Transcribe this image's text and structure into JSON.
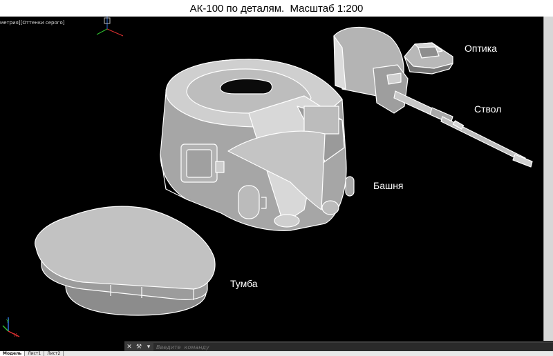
{
  "title": "АК-100 по деталям.  Масштаб 1:200",
  "viewport": {
    "label": "метрия][Оттенки серого]"
  },
  "labels": {
    "optics": "Оптика",
    "barrel": "Ствол",
    "turret": "Башня",
    "pedestal": "Тумба"
  },
  "command_line": {
    "placeholder": "Введите  команду",
    "close_glyph": "✕",
    "tool_glyph": "⚒",
    "history_glyph": "▾"
  },
  "tabs": [
    {
      "label": "Модель",
      "active": true
    },
    {
      "label": "Лист1",
      "active": false
    },
    {
      "label": "Лист2",
      "active": false
    }
  ],
  "colors": {
    "background": "#000000",
    "edge": "#ffffff",
    "face_light": "#c8c8c8",
    "face_dark": "#8c8c8c",
    "ucs_x": "#e03030",
    "ucs_y": "#30c030",
    "ucs_z": "#3070e0"
  }
}
